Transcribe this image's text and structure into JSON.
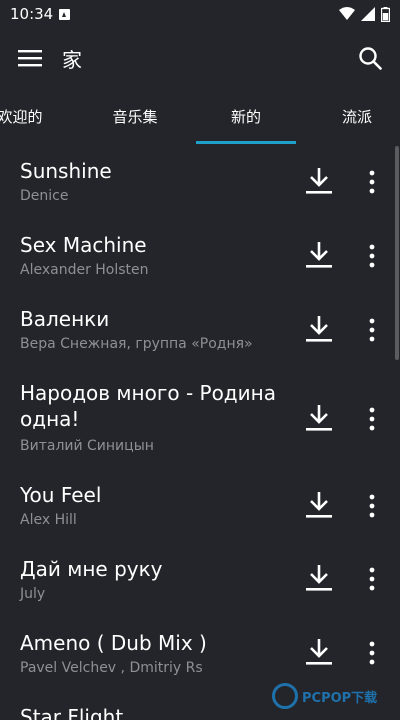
{
  "status": {
    "time": "10:34"
  },
  "appbar": {
    "title": "家",
    "menu_icon": "menu-icon",
    "search_icon": "search-icon"
  },
  "tabs": [
    {
      "label": "欢迎的",
      "active": false
    },
    {
      "label": "音乐集",
      "active": false
    },
    {
      "label": "新的",
      "active": true
    },
    {
      "label": "流派",
      "active": false
    }
  ],
  "songs": [
    {
      "title": "Sunshine",
      "artist": "Denice"
    },
    {
      "title": "Sex Machine",
      "artist": "Alexander Holsten"
    },
    {
      "title": "Валенки",
      "artist": "Вера Снежная, группа «Родня»"
    },
    {
      "title": "Народов много - Родина одна!",
      "artist": "Виталий Синицын"
    },
    {
      "title": "You Feel",
      "artist": "Alex Hill"
    },
    {
      "title": "Дай мне руку",
      "artist": "July"
    },
    {
      "title": "Ameno ( Dub Mix )",
      "artist": "Pavel Velchev , Dmitriy Rs"
    },
    {
      "title": "Star Flight",
      "artist": ""
    }
  ],
  "watermark": {
    "text": "PCPOP下载"
  },
  "colors": {
    "background": "#23252a",
    "accent": "#1ea0c8",
    "secondary_text": "#8e9095"
  }
}
